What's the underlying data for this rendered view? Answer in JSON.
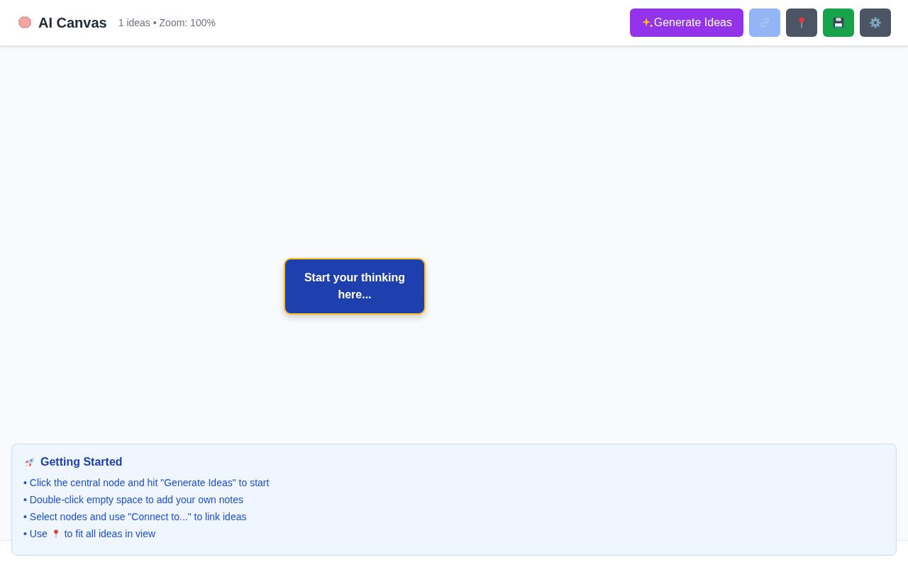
{
  "header": {
    "title": "AI Canvas",
    "status": "1 ideas • Zoom: 100%"
  },
  "toolbar": [
    {
      "kind": "generate",
      "label": "Generate Ideas",
      "color": "#9333ea",
      "disabled": false
    },
    {
      "kind": "link",
      "color": "#93b4f5",
      "disabled": true
    },
    {
      "kind": "pin",
      "color": "#4b5563",
      "disabled": false
    },
    {
      "kind": "save",
      "color": "#16a34a",
      "disabled": false
    },
    {
      "kind": "settings",
      "color": "#4b5563",
      "disabled": false
    }
  ],
  "canvas": {
    "nodes": [
      {
        "text": "Start your thinking here...",
        "selected": true
      }
    ]
  },
  "getting_started": {
    "title": "Getting Started",
    "tips": [
      {
        "text": "• Click the central node and hit \"Generate Ideas\" to start"
      },
      {
        "text": "• Double-click empty space to add your own notes"
      },
      {
        "text": "• Select nodes and use \"Connect to...\" to link ideas"
      },
      {
        "kind": "with_icon",
        "text": "• Use",
        "text_after": "to fit all ideas in view"
      }
    ]
  }
}
